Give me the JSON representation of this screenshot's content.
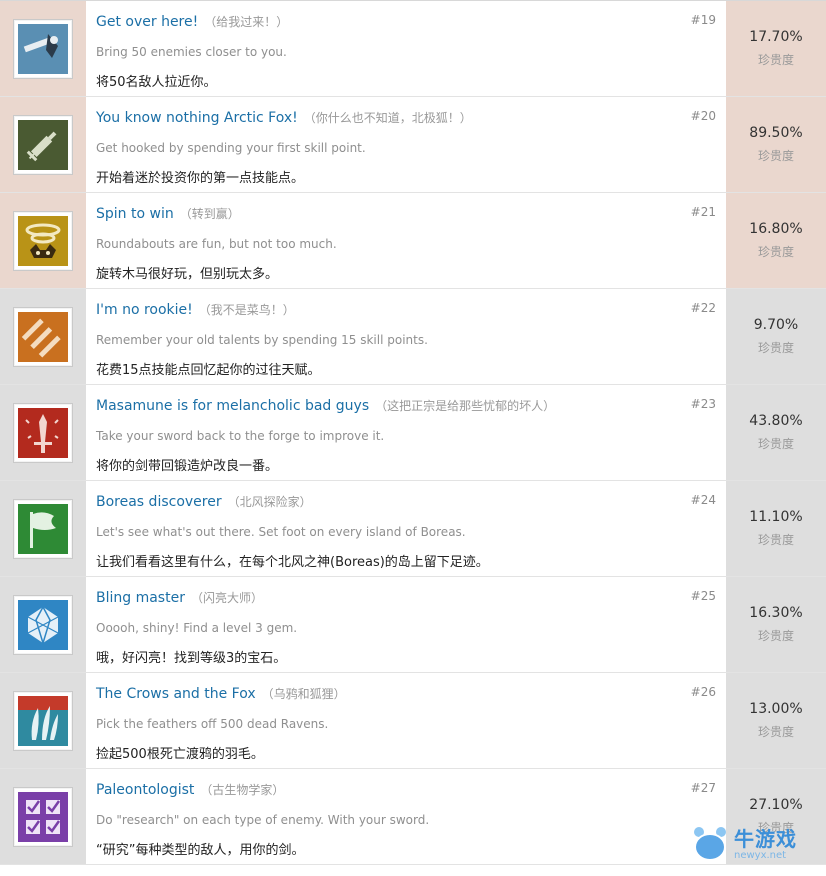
{
  "achievements": [
    {
      "title": "Get over here!",
      "title_cn": "（给我过来！）",
      "number": "#19",
      "desc_en": "Bring 50 enemies closer to you.",
      "desc_zh": "将50名敌人拉近你。",
      "percent": "17.70%",
      "rarity": "珍贵度",
      "state": "unlocked",
      "icon": "hook-pull-icon",
      "icon_bg": "#5a8fb3",
      "icon_fg": "#e8eef2"
    },
    {
      "title": "You know nothing Arctic Fox!",
      "title_cn": "（你什么也不知道，北极狐！）",
      "number": "#20",
      "desc_en": "Get hooked by spending your first skill point.",
      "desc_zh": "开始着迷於投资你的第一点技能点。",
      "percent": "89.50%",
      "rarity": "珍贵度",
      "state": "unlocked",
      "icon": "syringe-icon",
      "icon_bg": "#4a5a32",
      "icon_fg": "#d9dfc8"
    },
    {
      "title": "Spin to win",
      "title_cn": "（转到赢）",
      "number": "#21",
      "desc_en": "Roundabouts are fun, but not too much.",
      "desc_zh": "旋转木马很好玩，但别玩太多。",
      "percent": "16.80%",
      "rarity": "珍贵度",
      "state": "unlocked",
      "icon": "whirlwind-fox-icon",
      "icon_bg": "#b99317",
      "icon_fg": "#f3e9c2"
    },
    {
      "title": "I'm no rookie!",
      "title_cn": "（我不是菜鸟！）",
      "number": "#22",
      "desc_en": "Remember your old talents by spending 15 skill points.",
      "desc_zh": "花费15点技能点回忆起你的过往天赋。",
      "percent": "9.70%",
      "rarity": "珍贵度",
      "state": "locked",
      "icon": "syringes-icon",
      "icon_bg": "#c9701f",
      "icon_fg": "#f4dcc0"
    },
    {
      "title": "Masamune is for melancholic bad guys",
      "title_cn": "（这把正宗是给那些忧郁的坏人）",
      "number": "#23",
      "desc_en": "Take your sword back to the forge to improve it.",
      "desc_zh": "将你的剑带回锻造炉改良一番。",
      "percent": "43.80%",
      "rarity": "珍贵度",
      "state": "locked",
      "icon": "sword-icon",
      "icon_bg": "#b32a1e",
      "icon_fg": "#f2d6cf"
    },
    {
      "title": "Boreas discoverer",
      "title_cn": "（北风探险家）",
      "number": "#24",
      "desc_en": "Let's see what's out there. Set foot on every island of Boreas.",
      "desc_zh": "让我们看看这里有什么，在每个北风之神(Boreas)的岛上留下足迹。",
      "percent": "11.10%",
      "rarity": "珍贵度",
      "state": "locked",
      "icon": "flag-icon",
      "icon_bg": "#2e8a35",
      "icon_fg": "#e3f1e2"
    },
    {
      "title": "Bling master",
      "title_cn": "（闪亮大师）",
      "number": "#25",
      "desc_en": "Ooooh, shiny! Find a level 3 gem.",
      "desc_zh": "哦，好闪亮！找到等级3的宝石。",
      "percent": "16.30%",
      "rarity": "珍贵度",
      "state": "locked",
      "icon": "gem-icon",
      "icon_bg": "#2f86c4",
      "icon_fg": "#e5f0f8"
    },
    {
      "title": "The Crows and the Fox",
      "title_cn": "（乌鸦和狐狸）",
      "number": "#26",
      "desc_en": "Pick the feathers off 500 dead Ravens.",
      "desc_zh": "捡起500根死亡渡鸦的羽毛。",
      "percent": "13.00%",
      "rarity": "珍贵度",
      "state": "locked",
      "icon": "feathers-icon",
      "icon_bg": "#2f8aa0",
      "icon_fg": "#e6f2f4"
    },
    {
      "title": "Paleontologist",
      "title_cn": "（古生物学家）",
      "number": "#27",
      "desc_en": "Do \"research\" on each type of enemy. With your sword.",
      "desc_zh": "“研究”每种类型的敌人，用你的剑。",
      "percent": "27.10%",
      "rarity": "珍贵度",
      "state": "locked",
      "icon": "checklist-icon",
      "icon_bg": "#7a3fa8",
      "icon_fg": "#efe3f7"
    }
  ],
  "watermark": {
    "brand": "牛游戏",
    "domain": "newyx.net"
  }
}
